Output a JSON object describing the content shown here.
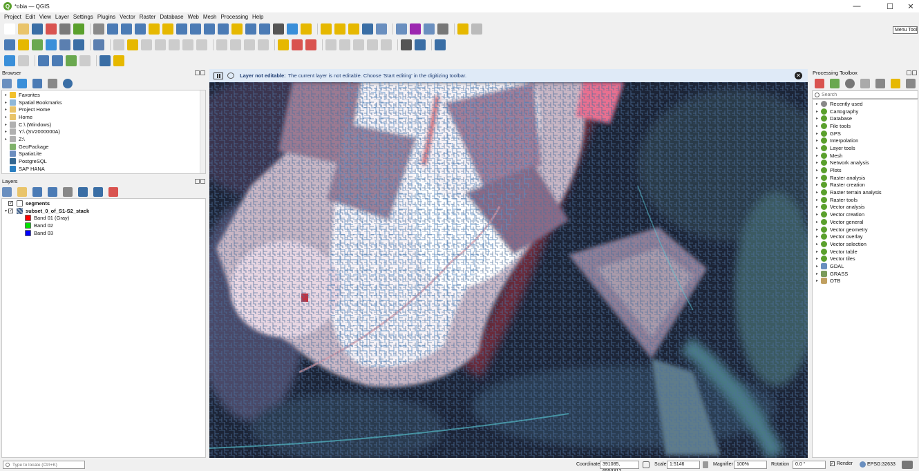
{
  "window": {
    "title": "*obia — QGIS",
    "controls": [
      "—",
      "☐",
      "✕"
    ]
  },
  "menu": [
    "Project",
    "Edit",
    "View",
    "Layer",
    "Settings",
    "Plugins",
    "Vector",
    "Raster",
    "Database",
    "Web",
    "Mesh",
    "Processing",
    "Help"
  ],
  "tooltip": "Menu Tool",
  "browser": {
    "title": "Browser",
    "items": [
      {
        "label": "Favorites",
        "icon": "star-icon",
        "color": "#f2c12e",
        "arrow": "▸"
      },
      {
        "label": "Spatial Bookmarks",
        "icon": "bookmark-icon",
        "color": "#8fb8d8",
        "arrow": "▸"
      },
      {
        "label": "Project Home",
        "icon": "folder-icon",
        "color": "#e9c46a",
        "arrow": "▸"
      },
      {
        "label": "Home",
        "icon": "folder-icon",
        "color": "#e9c46a",
        "arrow": "▸"
      },
      {
        "label": "C:\\ (Windows)",
        "icon": "drive-icon",
        "color": "#b0b0b0",
        "arrow": "▸"
      },
      {
        "label": "Y:\\ (SV2000000A)",
        "icon": "drive-icon",
        "color": "#b0b0b0",
        "arrow": "▸"
      },
      {
        "label": "Z:\\",
        "icon": "drive-icon",
        "color": "#b0b0b0",
        "arrow": "▸"
      },
      {
        "label": "GeoPackage",
        "icon": "geopackage-icon",
        "color": "#7fb16a",
        "arrow": ""
      },
      {
        "label": "SpatiaLite",
        "icon": "spatialite-icon",
        "color": "#6c8ebf",
        "arrow": ""
      },
      {
        "label": "PostgreSQL",
        "icon": "postgresql-icon",
        "color": "#336791",
        "arrow": ""
      },
      {
        "label": "SAP HANA",
        "icon": "saphana-icon",
        "color": "#2a7fc1",
        "arrow": ""
      }
    ]
  },
  "layers": {
    "title": "Layers",
    "items": [
      {
        "label": "segments",
        "bold": true,
        "level": 0,
        "checked": true,
        "arrow": "",
        "swatch": "#ffffff"
      },
      {
        "label": "subset_0_of_S1-S2_stack",
        "bold": true,
        "level": 0,
        "checked": true,
        "arrow": "▾",
        "swatch": "raster"
      },
      {
        "label": "Band 01 (Gray)",
        "bold": false,
        "level": 1,
        "checked": false,
        "arrow": "",
        "swatch": "#ff0000"
      },
      {
        "label": "Band 02",
        "bold": false,
        "level": 1,
        "checked": false,
        "arrow": "",
        "swatch": "#00e000"
      },
      {
        "label": "Band 03",
        "bold": false,
        "level": 1,
        "checked": false,
        "arrow": "",
        "swatch": "#0000ff"
      }
    ]
  },
  "message": {
    "bold": "Layer not editable:",
    "text": "The current layer is not editable. Choose 'Start editing' in the digitizing toolbar."
  },
  "processing": {
    "title": "Processing Toolbox",
    "search_placeholder": "Search",
    "items": [
      {
        "label": "Recently used",
        "icon": "clock-icon"
      },
      {
        "label": "Cartography",
        "icon": "qgis-icon"
      },
      {
        "label": "Database",
        "icon": "qgis-icon"
      },
      {
        "label": "File tools",
        "icon": "qgis-icon"
      },
      {
        "label": "GPS",
        "icon": "qgis-icon"
      },
      {
        "label": "Interpolation",
        "icon": "qgis-icon"
      },
      {
        "label": "Layer tools",
        "icon": "qgis-icon"
      },
      {
        "label": "Mesh",
        "icon": "qgis-icon"
      },
      {
        "label": "Network analysis",
        "icon": "qgis-icon"
      },
      {
        "label": "Plots",
        "icon": "qgis-icon"
      },
      {
        "label": "Raster analysis",
        "icon": "qgis-icon"
      },
      {
        "label": "Raster creation",
        "icon": "qgis-icon"
      },
      {
        "label": "Raster terrain analysis",
        "icon": "qgis-icon"
      },
      {
        "label": "Raster tools",
        "icon": "qgis-icon"
      },
      {
        "label": "Vector analysis",
        "icon": "qgis-icon"
      },
      {
        "label": "Vector creation",
        "icon": "qgis-icon"
      },
      {
        "label": "Vector general",
        "icon": "qgis-icon"
      },
      {
        "label": "Vector geometry",
        "icon": "qgis-icon"
      },
      {
        "label": "Vector overlay",
        "icon": "qgis-icon"
      },
      {
        "label": "Vector selection",
        "icon": "qgis-icon"
      },
      {
        "label": "Vector table",
        "icon": "qgis-icon"
      },
      {
        "label": "Vector tiles",
        "icon": "qgis-icon"
      },
      {
        "label": "GDAL",
        "icon": "gdal-icon"
      },
      {
        "label": "GRASS",
        "icon": "grass-icon"
      },
      {
        "label": "OTB",
        "icon": "otb-icon"
      }
    ]
  },
  "status": {
    "locate_placeholder": "Type to locate (Ctrl+K)",
    "coordinate_label": "Coordinate",
    "coordinate": "391085, 6553312",
    "scale_label": "Scale",
    "scale": "1:5146",
    "magnifier_label": "Magnifier",
    "magnifier": "100%",
    "rotation_label": "Rotation",
    "rotation": "0.0 °",
    "render_label": "Render",
    "crs": "EPSG:32633"
  },
  "toolbar_colors": {
    "tb1": [
      "#ffffff",
      "#e9c46a",
      "#3a6ea5",
      "#d9534f",
      "#7a7a7a",
      "#5aa02c",
      "#8a8a8a",
      "#4b7bb5",
      "#4b7bb5",
      "#4b7bb5",
      "#e6b800",
      "#e6b800",
      "#4b7bb5",
      "#4b7bb5",
      "#4b7bb5",
      "#4b7bb5",
      "#e6b800",
      "#4b7bb5",
      "#4b7bb5",
      "#555555",
      "#3a8fd9",
      "#e6b800",
      "#e6b800",
      "#e6b800",
      "#e6b800",
      "#3a6ea5",
      "#6a8fbf",
      "#6a8fbf",
      "#9c27b0",
      "#6a8fbf",
      "#777777",
      "#e6b800",
      "#bbbbbb"
    ],
    "tb2": [
      "#4b7bb5",
      "#e6b800",
      "#6aa84f",
      "#3a8fd9",
      "#5b7fb0",
      "#3a6ea5",
      "#5b7fb0",
      "#cccccc",
      "#e6b800",
      "#cccccc",
      "#cccccc",
      "#cccccc",
      "#cccccc",
      "#cccccc",
      "#cccccc",
      "#cccccc",
      "#cccccc",
      "#cccccc",
      "#e6b800",
      "#d9534f",
      "#d9534f",
      "#cccccc",
      "#cccccc",
      "#cccccc",
      "#cccccc",
      "#cccccc",
      "#555555",
      "#3a6ea5",
      "#3a6ea5"
    ],
    "tb3": [
      "#3a8fd9",
      "#cccccc",
      "#4b7bb5",
      "#4b7bb5",
      "#6aa84f",
      "#cccccc",
      "#3a6ea5",
      "#e6b800"
    ]
  }
}
